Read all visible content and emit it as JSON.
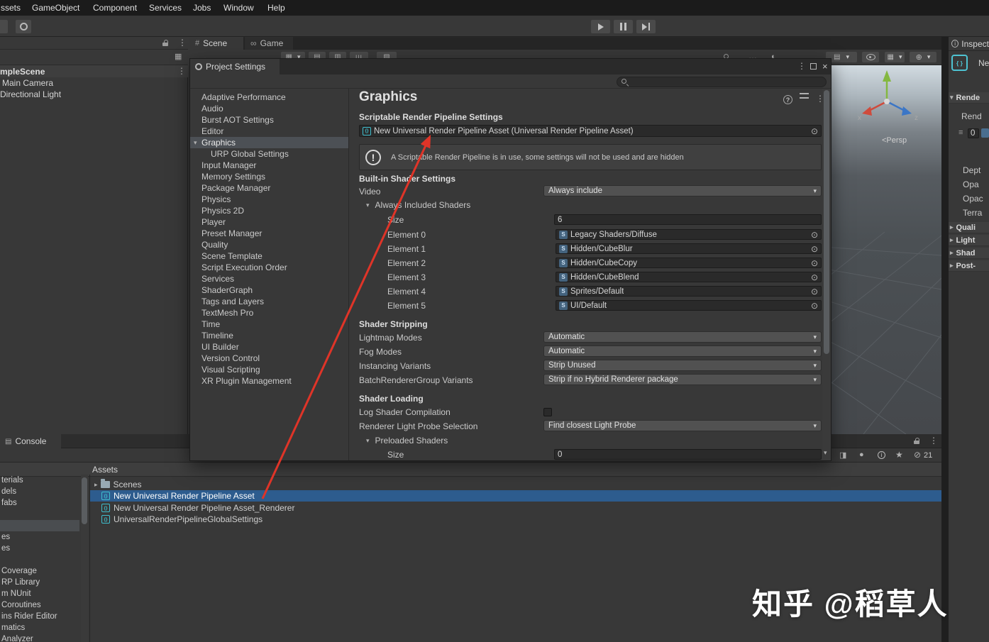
{
  "colors": {
    "selection_blue": "#2d5c8e",
    "tree_selection_gray": "#4a4d50",
    "arrow_red": "#df3428",
    "accent_teal": "#3fbfcf"
  },
  "menubar": {
    "items": [
      "ssets",
      "GameObject",
      "Component",
      "Services",
      "Jobs",
      "Window",
      "Help"
    ]
  },
  "view_tabs": {
    "scene": "Scene",
    "game": "Game"
  },
  "hierarchy": {
    "scene_name": "mpleScene",
    "items": [
      "Main Camera",
      "Directional Light"
    ]
  },
  "scene_view": {
    "persp_label": "<Persp",
    "axis_x": "x",
    "axis_z": "z"
  },
  "settings": {
    "tab_title": "Project Settings",
    "nav": [
      {
        "label": "Adaptive Performance"
      },
      {
        "label": "Audio"
      },
      {
        "label": "Burst AOT Settings"
      },
      {
        "label": "Editor"
      },
      {
        "label": "Graphics"
      },
      {
        "label": "URP Global Settings"
      },
      {
        "label": "Input Manager"
      },
      {
        "label": "Memory Settings"
      },
      {
        "label": "Package Manager"
      },
      {
        "label": "Physics"
      },
      {
        "label": "Physics 2D"
      },
      {
        "label": "Player"
      },
      {
        "label": "Preset Manager"
      },
      {
        "label": "Quality"
      },
      {
        "label": "Scene Template"
      },
      {
        "label": "Script Execution Order"
      },
      {
        "label": "Services"
      },
      {
        "label": "ShaderGraph"
      },
      {
        "label": "Tags and Layers"
      },
      {
        "label": "TextMesh Pro"
      },
      {
        "label": "Time"
      },
      {
        "label": "Timeline"
      },
      {
        "label": "UI Builder"
      },
      {
        "label": "Version Control"
      },
      {
        "label": "Visual Scripting"
      },
      {
        "label": "XR Plugin Management"
      }
    ],
    "page": {
      "title": "Graphics",
      "srp_heading": "Scriptable Render Pipeline Settings",
      "srp_value": "New Universal Render Pipeline Asset (Universal Render Pipeline Asset)",
      "info_text": "A Scriptable Render Pipeline is in use, some settings will not be used and are hidden",
      "builtin_heading": "Built-in Shader Settings",
      "video": {
        "label": "Video",
        "value": "Always include"
      },
      "always_included_label": "Always Included Shaders",
      "size": {
        "label": "Size",
        "value": "6"
      },
      "elements": [
        {
          "label": "Element 0",
          "value": "Legacy Shaders/Diffuse"
        },
        {
          "label": "Element 1",
          "value": "Hidden/CubeBlur"
        },
        {
          "label": "Element 2",
          "value": "Hidden/CubeCopy"
        },
        {
          "label": "Element 3",
          "value": "Hidden/CubeBlend"
        },
        {
          "label": "Element 4",
          "value": "Sprites/Default"
        },
        {
          "label": "Element 5",
          "value": "UI/Default"
        }
      ],
      "stripping_heading": "Shader Stripping",
      "stripping": [
        {
          "label": "Lightmap Modes",
          "value": "Automatic"
        },
        {
          "label": "Fog Modes",
          "value": "Automatic"
        },
        {
          "label": "Instancing Variants",
          "value": "Strip Unused"
        },
        {
          "label": "BatchRendererGroup Variants",
          "value": "Strip if no Hybrid Renderer package"
        }
      ],
      "loading_heading": "Shader Loading",
      "log_shader_label": "Log Shader Compilation",
      "probe": {
        "label": "Renderer Light Probe Selection",
        "value": "Find closest Light Probe"
      },
      "preloaded_label": "Preloaded Shaders",
      "preloaded_size": {
        "label": "Size",
        "value": "0"
      }
    }
  },
  "console": {
    "tab_title": "Console",
    "hidden_count": "21"
  },
  "project": {
    "header": "Assets",
    "tree_fragments": [
      "terials",
      "dels",
      "fabs",
      "",
      "",
      "es",
      "es",
      "",
      "Coverage",
      "RP Library",
      "m NUnit",
      "Coroutines",
      "ins Rider Editor",
      "matics",
      "Analyzer"
    ],
    "rows": [
      {
        "label": "Scenes"
      },
      {
        "label": "New Universal Render Pipeline Asset"
      },
      {
        "label": "New Universal Render Pipeline Asset_Renderer"
      },
      {
        "label": "UniversalRenderPipelineGlobalSettings"
      }
    ]
  },
  "inspector": {
    "tab_title": "Inspect",
    "asset_name": "Ne",
    "section_rendering": "Rende",
    "renderer_label": "Rend",
    "renderer_value": "0",
    "labels": [
      "Dept",
      "Opa",
      "Opac",
      "Terra"
    ],
    "sections": [
      "Quali",
      "Light",
      "Shad",
      "Post-"
    ]
  },
  "watermark": "知乎 @稻草人"
}
